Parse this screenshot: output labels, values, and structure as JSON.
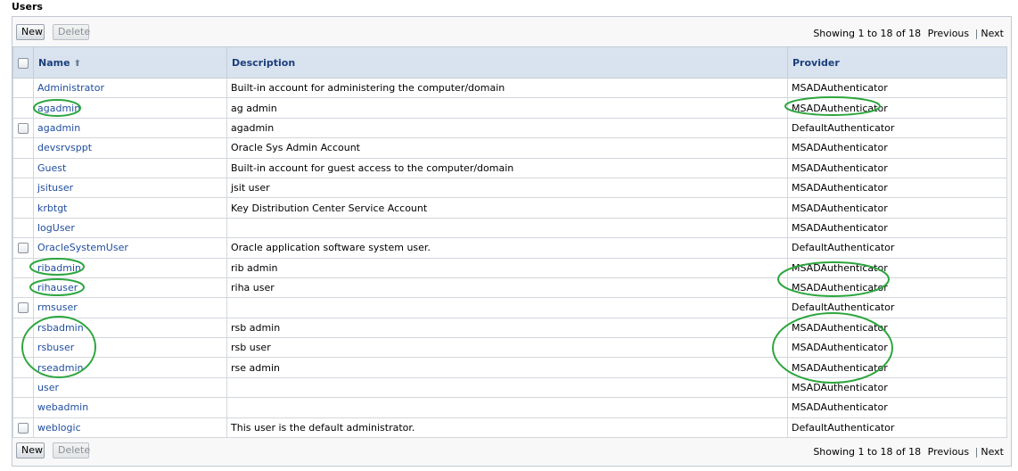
{
  "page": {
    "title": "Users"
  },
  "toolbar": {
    "new_label": "New",
    "delete_label": "Delete",
    "showing_text": "Showing 1 to 18 of 18",
    "previous_label": "Previous",
    "separator": "|",
    "next_label": "Next"
  },
  "table": {
    "columns": {
      "name": "Name",
      "description": "Description",
      "provider": "Provider"
    },
    "rows": [
      {
        "checkbox": false,
        "name": "Administrator",
        "description": "Built-in account for administering the computer/domain",
        "provider": "MSADAuthenticator"
      },
      {
        "checkbox": false,
        "name": "agadmin",
        "description": "ag admin",
        "provider": "MSADAuthenticator"
      },
      {
        "checkbox": true,
        "name": "agadmin",
        "description": "agadmin",
        "provider": "DefaultAuthenticator"
      },
      {
        "checkbox": false,
        "name": "devsrvsppt",
        "description": "Oracle Sys Admin Account",
        "provider": "MSADAuthenticator"
      },
      {
        "checkbox": false,
        "name": "Guest",
        "description": "Built-in account for guest access to the computer/domain",
        "provider": "MSADAuthenticator"
      },
      {
        "checkbox": false,
        "name": "jsituser",
        "description": "jsit user",
        "provider": "MSADAuthenticator"
      },
      {
        "checkbox": false,
        "name": "krbtgt",
        "description": "Key Distribution Center Service Account",
        "provider": "MSADAuthenticator"
      },
      {
        "checkbox": false,
        "name": "logUser",
        "description": "",
        "provider": "MSADAuthenticator"
      },
      {
        "checkbox": true,
        "name": "OracleSystemUser",
        "description": "Oracle application software system user.",
        "provider": "DefaultAuthenticator"
      },
      {
        "checkbox": false,
        "name": "ribadmin",
        "description": "rib admin",
        "provider": "MSADAuthenticator"
      },
      {
        "checkbox": false,
        "name": "rihauser",
        "description": "riha user",
        "provider": "MSADAuthenticator"
      },
      {
        "checkbox": true,
        "name": "rmsuser",
        "description": "",
        "provider": "DefaultAuthenticator"
      },
      {
        "checkbox": false,
        "name": "rsbadmin",
        "description": "rsb admin",
        "provider": "MSADAuthenticator"
      },
      {
        "checkbox": false,
        "name": "rsbuser",
        "description": "rsb user",
        "provider": "MSADAuthenticator"
      },
      {
        "checkbox": false,
        "name": "rseadmin",
        "description": "rse admin",
        "provider": "MSADAuthenticator"
      },
      {
        "checkbox": false,
        "name": "user",
        "description": "",
        "provider": "MSADAuthenticator"
      },
      {
        "checkbox": false,
        "name": "webadmin",
        "description": "",
        "provider": "MSADAuthenticator"
      },
      {
        "checkbox": true,
        "name": "weblogic",
        "description": "This user is the default administrator.",
        "provider": "DefaultAuthenticator"
      }
    ]
  },
  "annotations": {
    "highlight_color": "#2ea63f"
  },
  "colors": {
    "header_bg": "#d9e3ef",
    "link": "#1f4d9e",
    "header_text": "#1c3f7c"
  }
}
